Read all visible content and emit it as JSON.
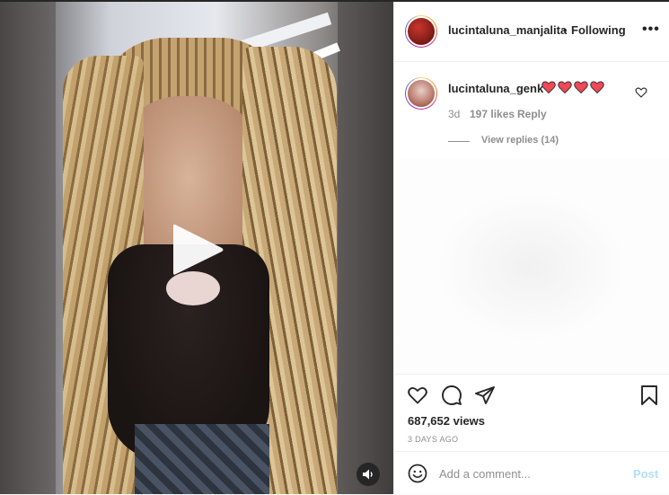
{
  "post": {
    "owner_username": "lucintaluna_manjalita",
    "separator": "•",
    "follow_status": "Following",
    "more_options_glyph": "•••",
    "views_text": "687,652 views",
    "posted_ago": "3 DAYS AGO"
  },
  "comment": {
    "username": "lucintaluna_genk",
    "hearts_count": 4,
    "heart_color": "#ed4956",
    "age": "3d",
    "likes": "197 likes",
    "reply_label": "Reply",
    "view_replies_label": "View replies (14)"
  },
  "composer": {
    "placeholder": "Add a comment...",
    "post_label": "Post"
  },
  "icons": {
    "play": "play-icon",
    "mute": "speaker-icon",
    "like": "heart-outline-icon",
    "comment": "comment-bubble-icon",
    "share": "paper-plane-icon",
    "save": "bookmark-icon",
    "emoji": "smiley-icon"
  },
  "colors": {
    "text": "#262626",
    "muted": "#8e8e8e",
    "post_button_disabled": "#b2dffc",
    "heart": "#ed4956"
  }
}
